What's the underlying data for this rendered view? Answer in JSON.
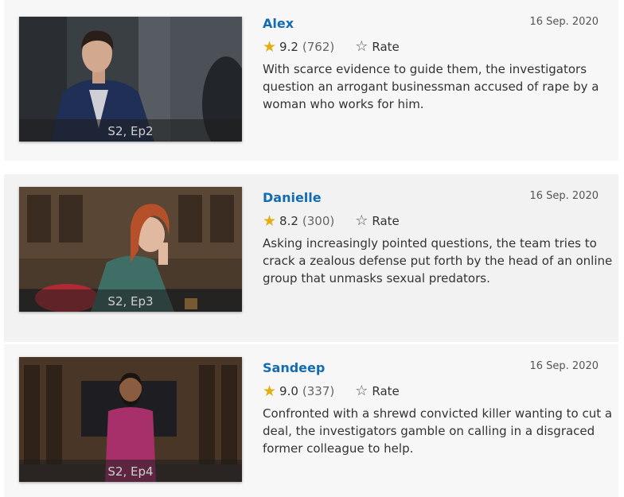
{
  "episodes": [
    {
      "title": "Alex",
      "episode_label": "S2, Ep2",
      "airdate": "16 Sep. 2020",
      "rating": "9.2",
      "votes": "(762)",
      "rate_label": "Rate",
      "description": "With scarce evidence to guide them, the investigators question an arrogant businessman accused of rape by a woman who works for him."
    },
    {
      "title": "Danielle",
      "episode_label": "S2, Ep3",
      "airdate": "16 Sep. 2020",
      "rating": "8.2",
      "votes": "(300)",
      "rate_label": "Rate",
      "description": "Asking increasingly pointed questions, the team tries to crack a zealous defense put forth by the head of an online group that unmasks sexual predators."
    },
    {
      "title": "Sandeep",
      "episode_label": "S2, Ep4",
      "airdate": "16 Sep. 2020",
      "rating": "9.0",
      "votes": "(337)",
      "rate_label": "Rate",
      "description": "Confronted with a shrewd convicted killer wanting to cut a deal, the investigators gamble on calling in a disgraced former colleague to help."
    }
  ],
  "icons": {
    "rating": "star-icon",
    "rate": "star-outline-icon"
  },
  "colors": {
    "title_link": "#136cb2",
    "star": "#e2ae12"
  }
}
